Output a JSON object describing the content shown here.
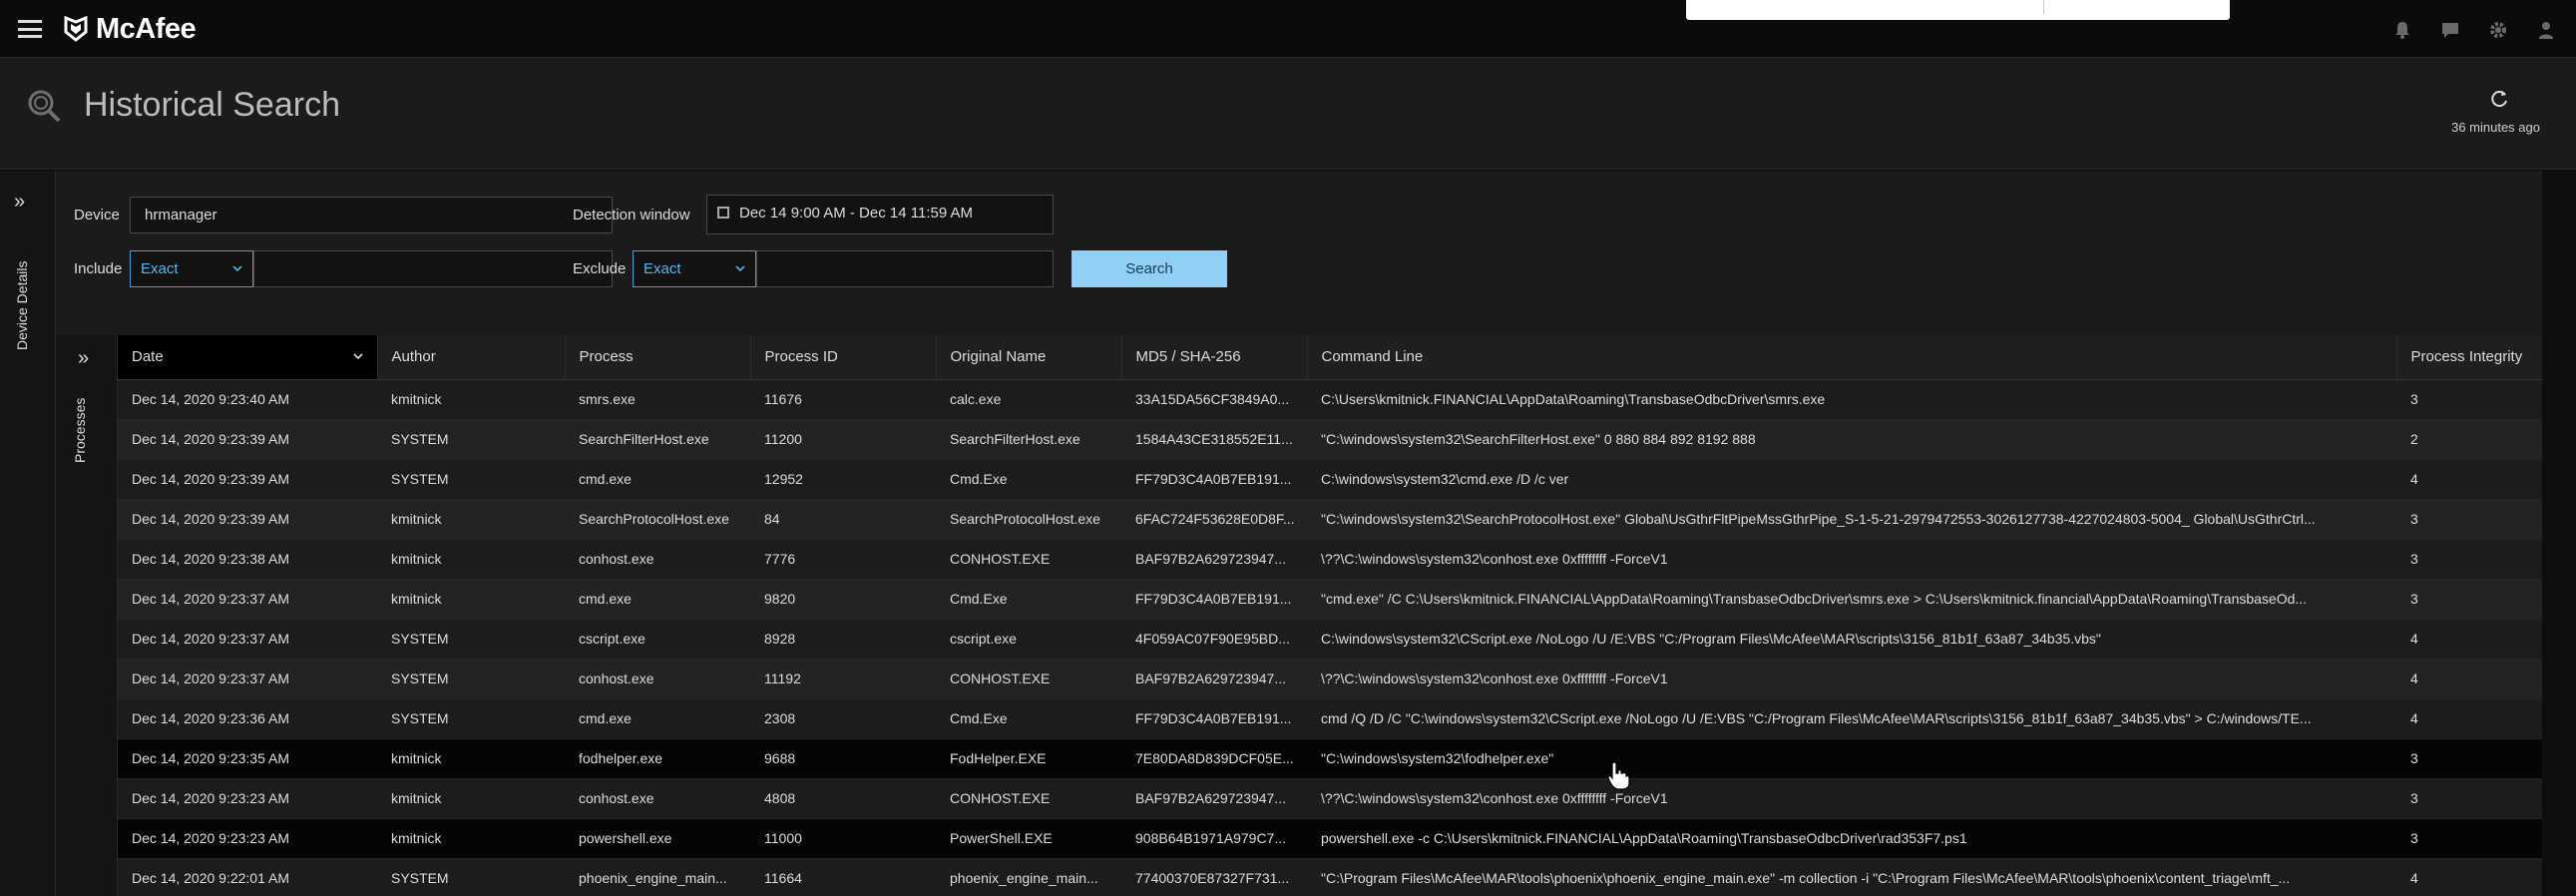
{
  "app": {
    "brand": "McAfee"
  },
  "header": {
    "title": "Historical Search",
    "updated": "36 minutes ago"
  },
  "left_tabs": {
    "device_details": "Device Details",
    "processes": "Processes"
  },
  "filters": {
    "device_label": "Device",
    "device_value": "hrmanager",
    "window_label": "Detection window",
    "window_value": "Dec 14 9:00 AM - Dec 14 11:59 AM",
    "include_label": "Include",
    "include_mode": "Exact",
    "exclude_label": "Exclude",
    "exclude_mode": "Exact",
    "search_label": "Search"
  },
  "table": {
    "columns": [
      "Date",
      "Author",
      "Process",
      "Process ID",
      "Original Name",
      "MD5 / SHA-256",
      "Command Line",
      "Process Integrity"
    ],
    "rows": [
      [
        "Dec 14, 2020 9:23:40 AM",
        "kmitnick",
        "smrs.exe",
        "11676",
        "calc.exe",
        "33A15DA56CF3849A0...",
        "C:\\Users\\kmitnick.FINANCIAL\\AppData\\Roaming\\TransbaseOdbcDriver\\smrs.exe",
        "3"
      ],
      [
        "Dec 14, 2020 9:23:39 AM",
        "SYSTEM",
        "SearchFilterHost.exe",
        "11200",
        "SearchFilterHost.exe",
        "1584A43CE318552E11...",
        "\"C:\\windows\\system32\\SearchFilterHost.exe\" 0 880 884 892 8192 888",
        "2"
      ],
      [
        "Dec 14, 2020 9:23:39 AM",
        "SYSTEM",
        "cmd.exe",
        "12952",
        "Cmd.Exe",
        "FF79D3C4A0B7EB191...",
        "C:\\windows\\system32\\cmd.exe /D /c ver",
        "4"
      ],
      [
        "Dec 14, 2020 9:23:39 AM",
        "kmitnick",
        "SearchProtocolHost.exe",
        "84",
        "SearchProtocolHost.exe",
        "6FAC724F53628E0D8F...",
        "\"C:\\windows\\system32\\SearchProtocolHost.exe\" Global\\UsGthrFltPipeMssGthrPipe_S-1-5-21-2979472553-3026127738-4227024803-5004_ Global\\UsGthrCtrl...",
        "3"
      ],
      [
        "Dec 14, 2020 9:23:38 AM",
        "kmitnick",
        "conhost.exe",
        "7776",
        "CONHOST.EXE",
        "BAF97B2A629723947...",
        "\\??\\C:\\windows\\system32\\conhost.exe 0xffffffff -ForceV1",
        "3"
      ],
      [
        "Dec 14, 2020 9:23:37 AM",
        "kmitnick",
        "cmd.exe",
        "9820",
        "Cmd.Exe",
        "FF79D3C4A0B7EB191...",
        "\"cmd.exe\" /C C:\\Users\\kmitnick.FINANCIAL\\AppData\\Roaming\\TransbaseOdbcDriver\\smrs.exe > C:\\Users\\kmitnick.financial\\AppData\\Roaming\\TransbaseOd...",
        "3"
      ],
      [
        "Dec 14, 2020 9:23:37 AM",
        "SYSTEM",
        "cscript.exe",
        "8928",
        "cscript.exe",
        "4F059AC07F90E95BD...",
        "C:\\windows\\system32\\CScript.exe /NoLogo /U /E:VBS \"C:/Program Files\\McAfee\\MAR\\scripts\\3156_81b1f_63a87_34b35.vbs\"",
        "4"
      ],
      [
        "Dec 14, 2020 9:23:37 AM",
        "SYSTEM",
        "conhost.exe",
        "11192",
        "CONHOST.EXE",
        "BAF97B2A629723947...",
        "\\??\\C:\\windows\\system32\\conhost.exe 0xffffffff -ForceV1",
        "4"
      ],
      [
        "Dec 14, 2020 9:23:36 AM",
        "SYSTEM",
        "cmd.exe",
        "2308",
        "Cmd.Exe",
        "FF79D3C4A0B7EB191...",
        "cmd /Q /D /C \"C:\\windows\\system32\\CScript.exe /NoLogo /U /E:VBS \"C:/Program Files\\McAfee\\MAR\\scripts\\3156_81b1f_63a87_34b35.vbs\" > C:/windows/TE...",
        "4"
      ],
      [
        "Dec 14, 2020 9:23:35 AM",
        "kmitnick",
        "fodhelper.exe",
        "9688",
        "FodHelper.EXE",
        "7E80DA8D839DCF05E...",
        "\"C:\\windows\\system32\\fodhelper.exe\"",
        "3"
      ],
      [
        "Dec 14, 2020 9:23:23 AM",
        "kmitnick",
        "conhost.exe",
        "4808",
        "CONHOST.EXE",
        "BAF97B2A629723947...",
        "\\??\\C:\\windows\\system32\\conhost.exe 0xffffffff -ForceV1",
        "3"
      ],
      [
        "Dec 14, 2020 9:23:23 AM",
        "kmitnick",
        "powershell.exe",
        "11000",
        "PowerShell.EXE",
        "908B64B1971A979C7...",
        "powershell.exe -c C:\\Users\\kmitnick.FINANCIAL\\AppData\\Roaming\\TransbaseOdbcDriver\\rad353F7.ps1",
        "3"
      ],
      [
        "Dec 14, 2020 9:22:01 AM",
        "SYSTEM",
        "phoenix_engine_main...",
        "11664",
        "phoenix_engine_main...",
        "77400370E87327F731...",
        "\"C:\\Program Files\\McAfee\\MAR\\tools\\phoenix\\phoenix_engine_main.exe\" -m collection -i \"C:\\Program Files\\McAfee\\MAR\\tools\\phoenix\\content_triage\\mft_...",
        "4"
      ]
    ],
    "selected_rows": [
      9,
      11
    ]
  },
  "icons": [
    "menu-icon",
    "mcafee-shield-icon",
    "bell-icon",
    "chat-icon",
    "gear-icon",
    "user-icon",
    "history-search-icon",
    "refresh-icon",
    "expand-icon",
    "calendar-icon",
    "chevron-down-icon",
    "cursor-hand-icon"
  ],
  "colors": {
    "accent": "#3fa0d8",
    "search_button": "#8fd0f4",
    "background": "#1b1b1b"
  }
}
